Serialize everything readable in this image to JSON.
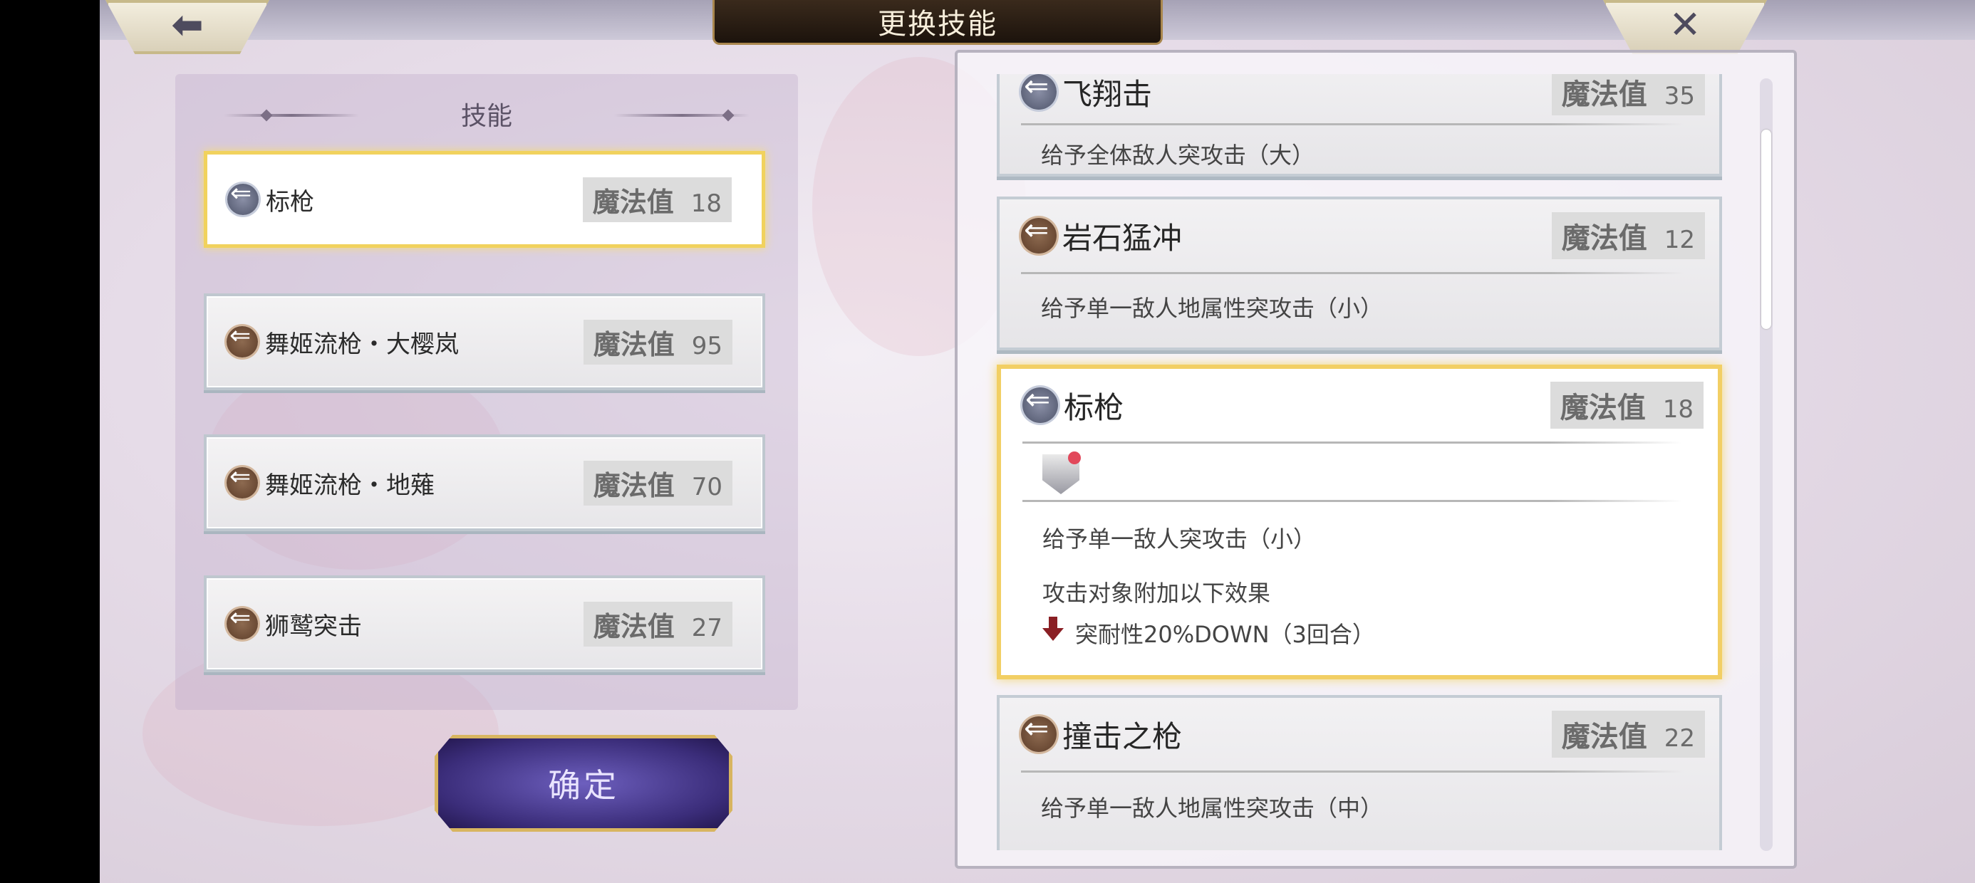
{
  "header": {
    "title": "更换技能",
    "back_icon": "arrow-left-icon",
    "close_icon": "close-icon"
  },
  "left": {
    "header": "技能",
    "slots": [
      {
        "name": "标枪",
        "mp_label": "魔法值",
        "mp": "18",
        "icon": "spear-icon-silver"
      },
      {
        "name": "舞姬流枪・大樱岚",
        "mp_label": "魔法值",
        "mp": "95",
        "icon": "spear-icon-bronze"
      },
      {
        "name": "舞姬流枪・地薙",
        "mp_label": "魔法值",
        "mp": "70",
        "icon": "spear-icon-bronze"
      },
      {
        "name": "狮鹫突击",
        "mp_label": "魔法值",
        "mp": "27",
        "icon": "spear-icon-bronze"
      }
    ],
    "confirm": "确定"
  },
  "right": {
    "cards": [
      {
        "name": "飞翔击",
        "mp_label": "魔法值",
        "mp": "35",
        "desc": "给予全体敌人突攻击（大）"
      },
      {
        "name": "岩石猛冲",
        "mp_label": "魔法值",
        "mp": "12",
        "desc": "给予单一敌人地属性突攻击（小）"
      },
      {
        "name": "标枪",
        "mp_label": "魔法值",
        "mp": "18",
        "desc": "给予单一敌人突攻击（小）",
        "effect_intro": "攻击对象附加以下效果",
        "effect": "突耐性20%DOWN（3回合）"
      },
      {
        "name": "撞击之枪",
        "mp_label": "魔法值",
        "mp": "22",
        "desc": "给予单一敌人地属性突攻击（中）"
      }
    ]
  }
}
